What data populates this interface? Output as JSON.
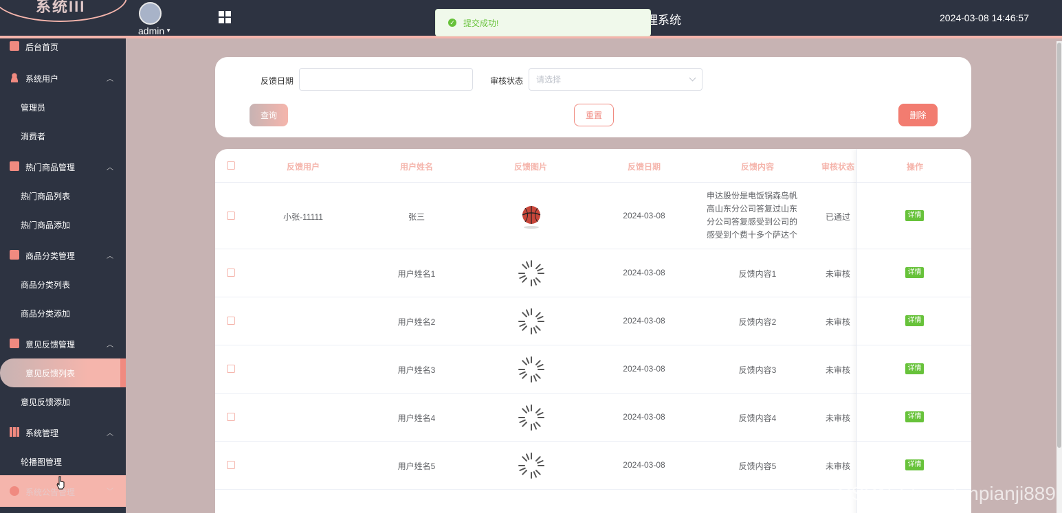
{
  "header": {
    "logo_text": "系统III",
    "user": "admin",
    "system_title": "理系统",
    "datetime": "2024-03-08 14:46:57"
  },
  "toast": {
    "message": "提交成功!"
  },
  "sidebar": {
    "items": [
      {
        "type": "group",
        "label": "后台首页",
        "icon": "monitor-icon"
      },
      {
        "type": "group",
        "label": "系统用户",
        "icon": "user-icon"
      },
      {
        "type": "item",
        "label": "管理员"
      },
      {
        "type": "item",
        "label": "消费者"
      },
      {
        "type": "group",
        "label": "热门商品管理",
        "icon": "chart-icon"
      },
      {
        "type": "item",
        "label": "热门商品列表"
      },
      {
        "type": "item",
        "label": "热门商品添加"
      },
      {
        "type": "group",
        "label": "商品分类管理",
        "icon": "chart-icon"
      },
      {
        "type": "item",
        "label": "商品分类列表"
      },
      {
        "type": "item",
        "label": "商品分类添加"
      },
      {
        "type": "group",
        "label": "意见反馈管理",
        "icon": "chart-icon"
      },
      {
        "type": "item",
        "label": "意见反馈列表",
        "active": true
      },
      {
        "type": "item",
        "label": "意见反馈添加"
      },
      {
        "type": "group",
        "label": "系统管理",
        "icon": "bar-chart-icon"
      },
      {
        "type": "item",
        "label": "轮播图管理"
      },
      {
        "type": "group",
        "label": "系统公告管理",
        "icon": "info-icon"
      }
    ]
  },
  "search": {
    "date_label": "反馈日期",
    "date_value": "",
    "status_label": "审核状态",
    "status_placeholder": "请选择",
    "query_button": "查询",
    "reset_button": "重置",
    "delete_button": "删除"
  },
  "table": {
    "columns": [
      "反馈用户",
      "用户姓名",
      "反馈图片",
      "反馈日期",
      "反馈内容",
      "审核状态",
      "操作"
    ],
    "rows": [
      {
        "user": "小张-11111",
        "name": "张三",
        "image": "basketball",
        "date": "2024-03-08",
        "content": "申达股份是电饭锅森岛帆高山东分公司答复过山东分公司答复感受到公司的感受到个费十多个萨达个",
        "status": "已通过",
        "action": "详情"
      },
      {
        "user": "",
        "name": "用户姓名1",
        "image": "loading",
        "date": "2024-03-08",
        "content": "反馈内容1",
        "status": "未审核",
        "action": "详情"
      },
      {
        "user": "",
        "name": "用户姓名2",
        "image": "loading",
        "date": "2024-03-08",
        "content": "反馈内容2",
        "status": "未审核",
        "action": "详情"
      },
      {
        "user": "",
        "name": "用户姓名3",
        "image": "loading",
        "date": "2024-03-08",
        "content": "反馈内容3",
        "status": "未审核",
        "action": "详情"
      },
      {
        "user": "",
        "name": "用户姓名4",
        "image": "loading",
        "date": "2024-03-08",
        "content": "反馈内容4",
        "status": "未审核",
        "action": "详情"
      },
      {
        "user": "",
        "name": "用户姓名5",
        "image": "loading",
        "date": "2024-03-08",
        "content": "反馈内容5",
        "status": "未审核",
        "action": "详情"
      }
    ]
  },
  "watermark": "CSDN @vx_danpianji889",
  "colors": {
    "accent": "#f5b5ac",
    "accent_dark": "#f08a80",
    "sidebar_bg": "#2d3341",
    "success": "#67c23a"
  }
}
